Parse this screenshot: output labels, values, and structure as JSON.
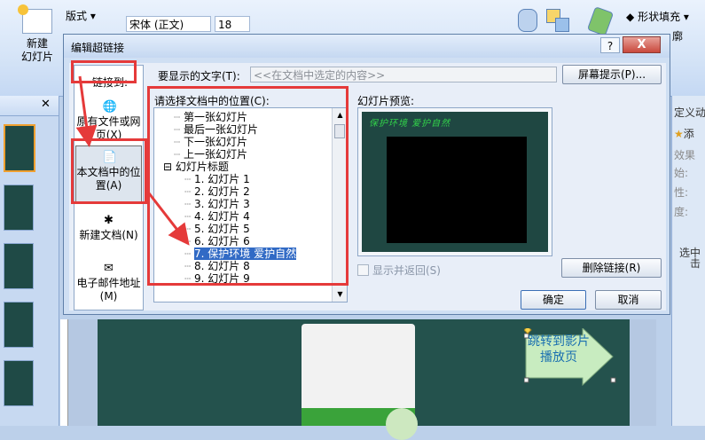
{
  "ribbon": {
    "new_slide": [
      "新建",
      "幻灯片"
    ],
    "layout": "版式",
    "font_name": "宋体 (正文)",
    "font_size": "18",
    "shape_fill": "形状填充",
    "shape_outline": "廓"
  },
  "taskpane": {
    "title": "定义动",
    "add": "添",
    "prop1": "效果",
    "prop2": "始:",
    "prop3": "性:",
    "prop4": "度:",
    "note1": "选中",
    "note2": "击"
  },
  "slide": {
    "arrow_label": "跳转到影片播放页"
  },
  "dialog": {
    "title": "编辑超链接",
    "help": "?",
    "close": "X",
    "link_to": "链接到:",
    "link_options": [
      {
        "label": "原有文件或网页(X)",
        "icon": "globe-file-icon"
      },
      {
        "label": "本文档中的位置(A)",
        "icon": "document-place-icon"
      },
      {
        "label": "新建文档(N)",
        "icon": "new-document-icon"
      },
      {
        "label": "电子邮件地址(M)",
        "icon": "email-icon"
      }
    ],
    "display_text_label": "要显示的文字(T):",
    "display_text_value": "<<在文档中选定的内容>>",
    "screen_tip": "屏幕提示(P)...",
    "place_label": "请选择文档中的位置(C):",
    "tree": [
      {
        "label": "第一张幻灯片",
        "level": 1
      },
      {
        "label": "最后一张幻灯片",
        "level": 1
      },
      {
        "label": "下一张幻灯片",
        "level": 1
      },
      {
        "label": "上一张幻灯片",
        "level": 1
      },
      {
        "label": "幻灯片标题",
        "level": 0
      },
      {
        "label": "1. 幻灯片 1",
        "level": 2
      },
      {
        "label": "2. 幻灯片 2",
        "level": 2
      },
      {
        "label": "3. 幻灯片 3",
        "level": 2
      },
      {
        "label": "4. 幻灯片 4",
        "level": 2
      },
      {
        "label": "5. 幻灯片 5",
        "level": 2
      },
      {
        "label": "6. 幻灯片 6",
        "level": 2
      },
      {
        "label": "7. 保护环境 爱护自然",
        "level": 2,
        "selected": true
      },
      {
        "label": "8. 幻灯片 8",
        "level": 2
      },
      {
        "label": "9. 幻灯片 9",
        "level": 2
      }
    ],
    "preview_label": "幻灯片预览:",
    "preview_slide_title": "保护环境 爱护自然",
    "show_and_return": "显示并返回(S)",
    "remove_link": "删除链接(R)",
    "ok": "确定",
    "cancel": "取消"
  },
  "colors": {
    "highlight": "#e53a3a",
    "selection": "#316ac5",
    "slide_bg": "#1f4742"
  }
}
